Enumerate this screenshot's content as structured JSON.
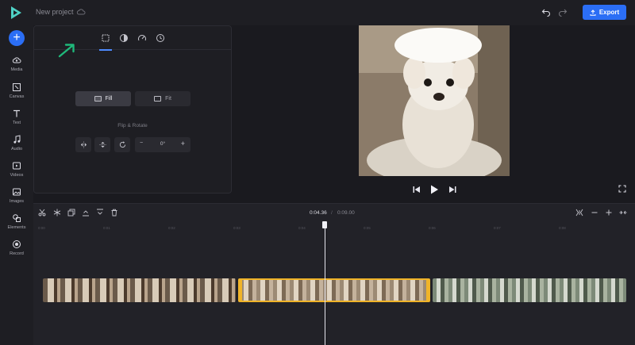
{
  "header": {
    "project_name": "New project",
    "export_label": "Export"
  },
  "sidebar": {
    "items": [
      {
        "label": "Media",
        "icon": "cloud-upload-icon"
      },
      {
        "label": "Canvas",
        "icon": "canvas-icon"
      },
      {
        "label": "Text",
        "icon": "text-icon"
      },
      {
        "label": "Audio",
        "icon": "music-note-icon"
      },
      {
        "label": "Videos",
        "icon": "video-icon"
      },
      {
        "label": "Images",
        "icon": "image-icon"
      },
      {
        "label": "Elements",
        "icon": "shapes-icon"
      },
      {
        "label": "Record",
        "icon": "record-icon"
      }
    ]
  },
  "panel": {
    "tabs": [
      "crop-resize-icon",
      "color-adjust-icon",
      "speed-icon",
      "clock-icon"
    ],
    "fill_label": "Fill",
    "fit_label": "Fit",
    "flip_rotate_label": "Flip & Rotate",
    "rotation_minus": "−",
    "rotation_value": "0°",
    "rotation_plus": "+"
  },
  "timeline": {
    "current_time": "0:04.36",
    "separator": "/",
    "total_time": "0:09.00",
    "ruler_ticks": [
      "0:00",
      "0:01",
      "0:02",
      "0:03",
      "0:04",
      "0:05",
      "0:06",
      "0:07",
      "0:08"
    ]
  },
  "colors": {
    "accent": "#2b6ef5",
    "selection": "#f0b429",
    "annotation_arrow": "#1fb87a"
  }
}
